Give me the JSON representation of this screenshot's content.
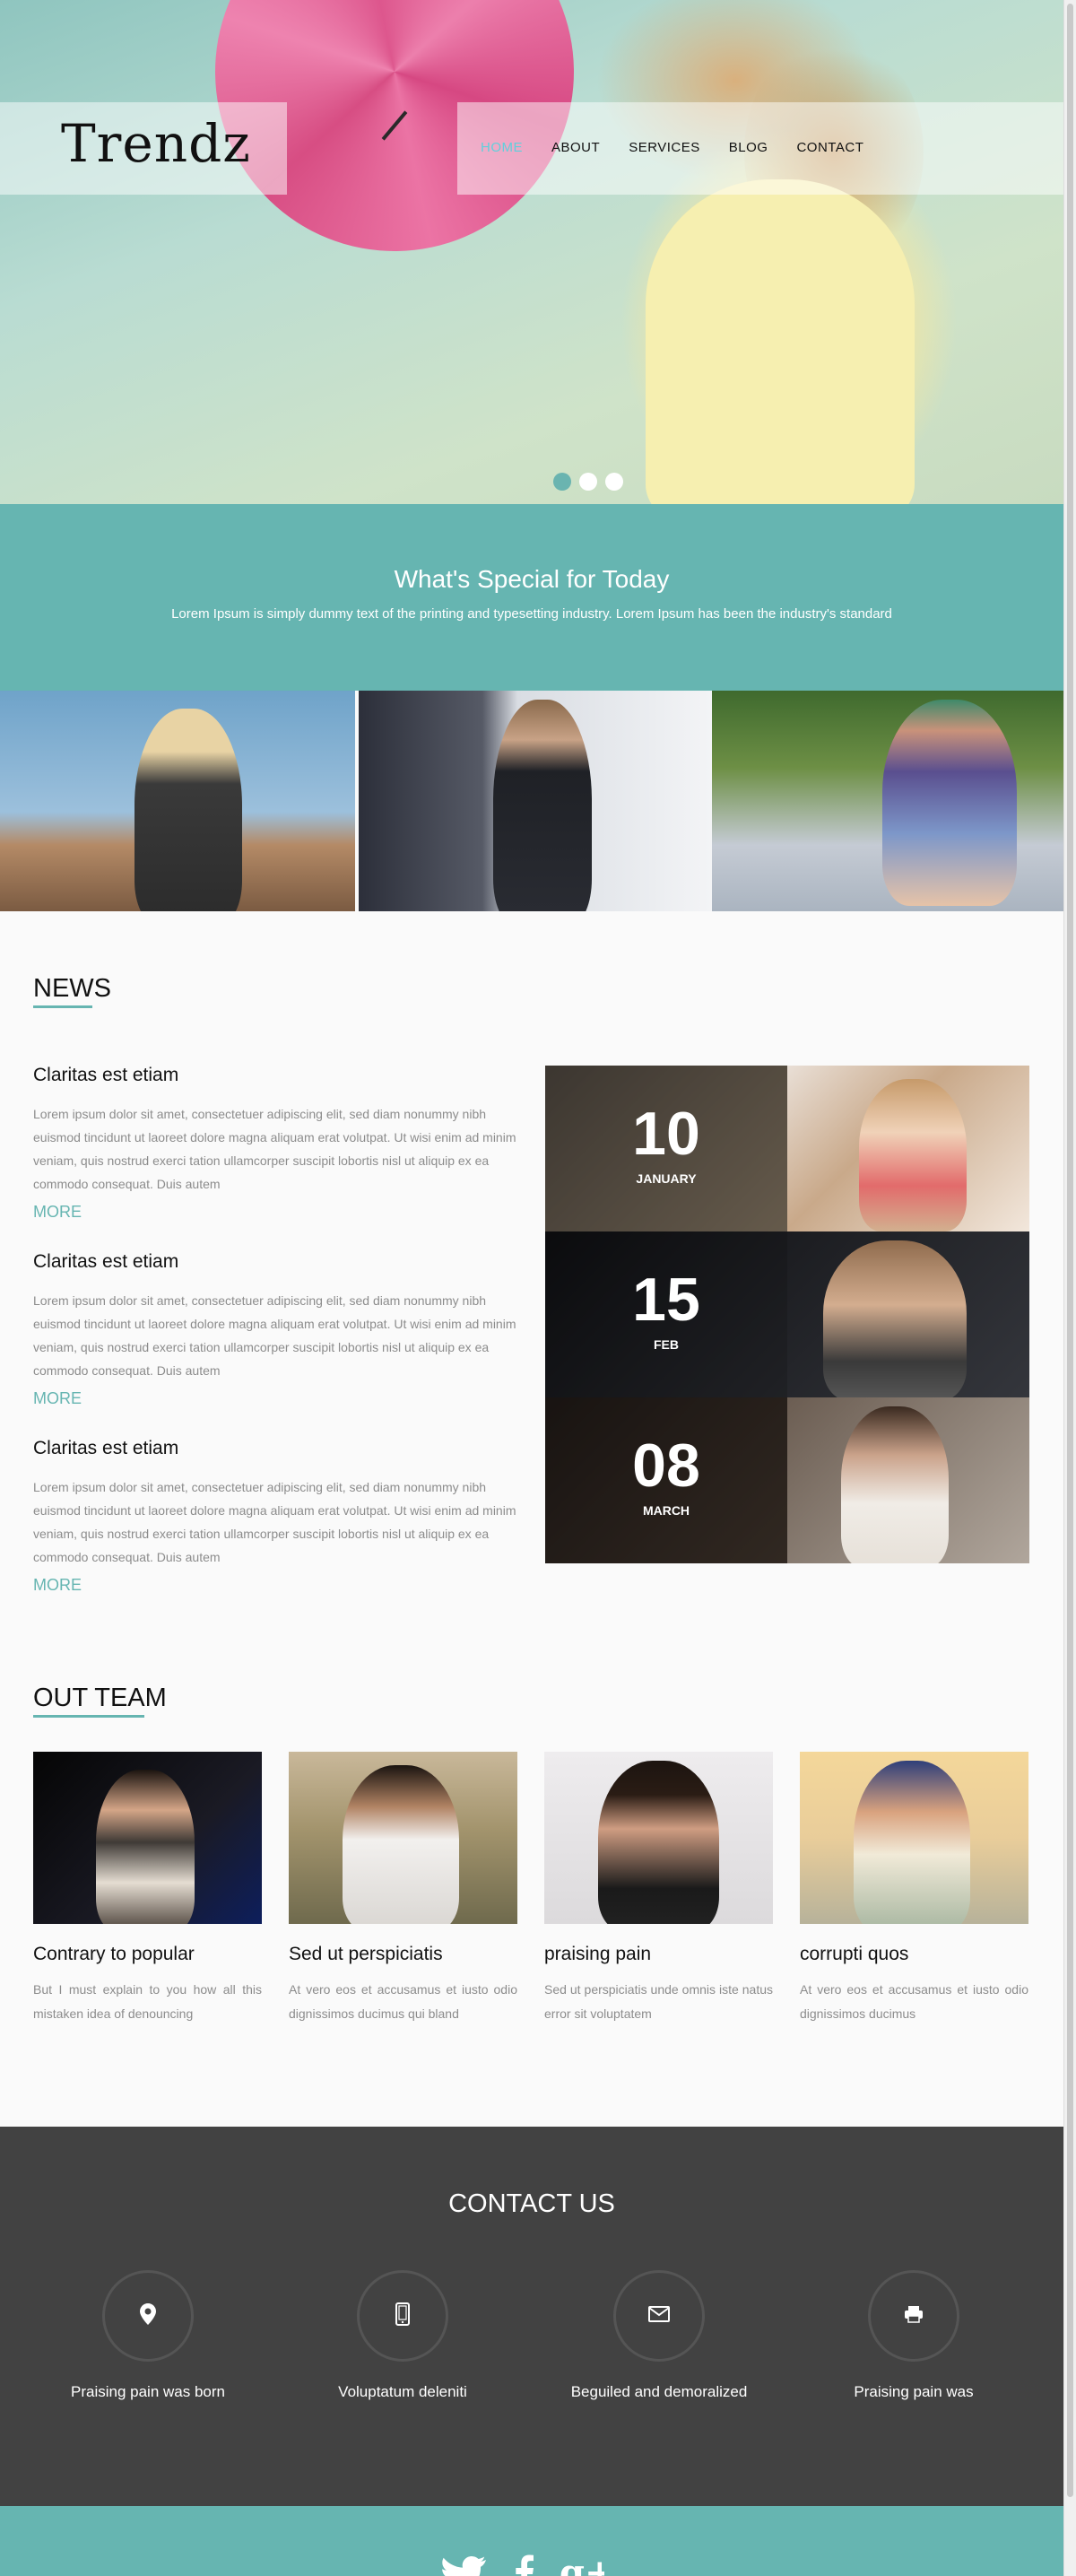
{
  "header": {
    "logo": "Trendz",
    "nav": [
      "HOME",
      "ABOUT",
      "SERVICES",
      "BLOG",
      "CONTACT"
    ],
    "active_nav": "HOME"
  },
  "hero": {
    "slides": 3,
    "active_slide": 1
  },
  "special": {
    "title": "What's Special for Today",
    "text": "Lorem Ipsum is simply dummy text of the printing and typesetting industry. Lorem Ipsum has been the industry's standard"
  },
  "news": {
    "title": "NEWS",
    "items": [
      {
        "title": "Claritas est etiam",
        "text": "Lorem ipsum dolor sit amet, consectetuer adipiscing elit, sed diam nonummy nibh euismod tincidunt ut laoreet dolore magna aliquam erat volutpat. Ut wisi enim ad minim veniam, quis nostrud exerci tation ullamcorper suscipit lobortis nisl ut aliquip ex ea commodo consequat. Duis autem",
        "more": "MORE"
      },
      {
        "title": "Claritas est etiam",
        "text": "Lorem ipsum dolor sit amet, consectetuer adipiscing elit, sed diam nonummy nibh euismod tincidunt ut laoreet dolore magna aliquam erat volutpat. Ut wisi enim ad minim veniam, quis nostrud exerci tation ullamcorper suscipit lobortis nisl ut aliquip ex ea commodo consequat. Duis autem",
        "more": "MORE"
      },
      {
        "title": "Claritas est etiam",
        "text": "Lorem ipsum dolor sit amet, consectetuer adipiscing elit, sed diam nonummy nibh euismod tincidunt ut laoreet dolore magna aliquam erat volutpat. Ut wisi enim ad minim veniam, quis nostrud exerci tation ullamcorper suscipit lobortis nisl ut aliquip ex ea commodo consequat. Duis autem",
        "more": "MORE"
      }
    ],
    "dates": [
      {
        "day": "10",
        "month": "JANUARY"
      },
      {
        "day": "15",
        "month": "FEB"
      },
      {
        "day": "08",
        "month": "MARCH"
      }
    ]
  },
  "team": {
    "title": "OUT TEAM",
    "members": [
      {
        "name": "Contrary to popular",
        "text": "But I must explain to you how all this mistaken idea of denouncing"
      },
      {
        "name": "Sed ut perspiciatis",
        "text": "At vero eos et accusamus et iusto odio dignissimos ducimus qui bland"
      },
      {
        "name": "praising pain",
        "text": "Sed ut perspiciatis unde omnis iste natus error sit voluptatem"
      },
      {
        "name": "corrupti quos",
        "text": "At vero eos et accusamus et iusto odio dignissimos ducimus"
      }
    ]
  },
  "contact": {
    "title": "CONTACT US",
    "items": [
      {
        "icon": "map-pin-icon",
        "label": "Praising pain was born"
      },
      {
        "icon": "mobile-phone-icon",
        "label": "Voluptatum deleniti"
      },
      {
        "icon": "envelope-icon",
        "label": "Beguiled and demoralized"
      },
      {
        "icon": "printer-icon",
        "label": "Praising pain was"
      }
    ]
  },
  "footer": {
    "social": [
      "twitter-icon",
      "facebook-icon",
      "google-plus-icon"
    ]
  },
  "colors": {
    "accent": "#66b5b1",
    "nav_active": "#5fd0dc",
    "contact_bg": "#424242",
    "text_muted": "#8c8c8c"
  }
}
